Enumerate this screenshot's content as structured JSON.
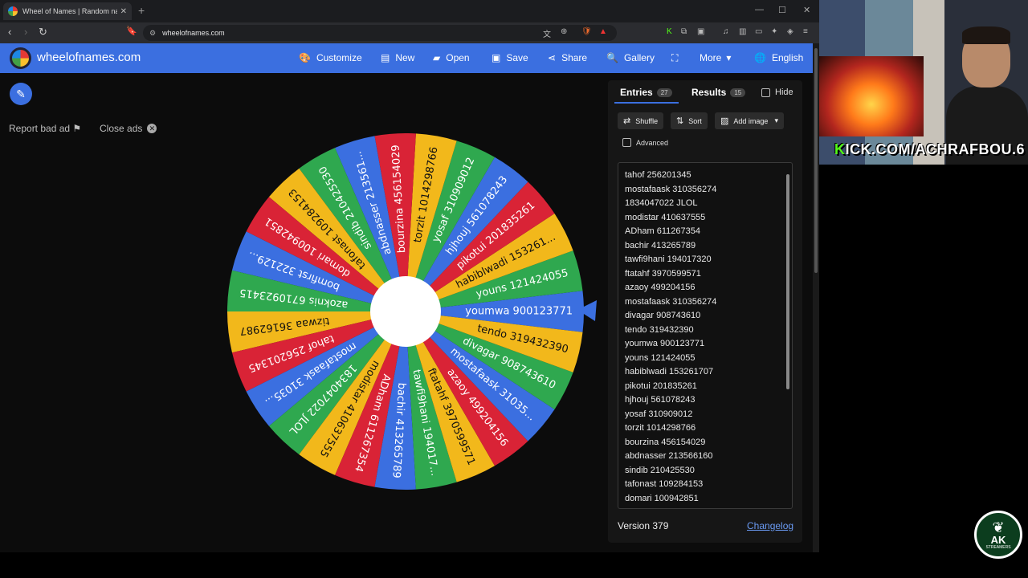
{
  "browser": {
    "tab_title": "Wheel of Names | Random name picker",
    "url": "wheelofnames.com"
  },
  "site": {
    "brand": "wheelofnames.com",
    "nav": [
      {
        "label": "Customize",
        "icon": "palette-icon"
      },
      {
        "label": "New",
        "icon": "file-icon"
      },
      {
        "label": "Open",
        "icon": "folder-open-icon"
      },
      {
        "label": "Save",
        "icon": "save-icon"
      },
      {
        "label": "Share",
        "icon": "share-icon"
      },
      {
        "label": "Gallery",
        "icon": "search-icon"
      },
      {
        "label": "",
        "icon": "fullscreen-icon"
      },
      {
        "label": "More",
        "icon": "chevron-down-icon"
      },
      {
        "label": "English",
        "icon": "globe-icon"
      }
    ],
    "report_bad_ad": "Report bad ad",
    "close_ads": "Close ads"
  },
  "wheel": {
    "colors": [
      "#3b6fe0",
      "#2fa84f",
      "#f2b81b",
      "#d92336"
    ],
    "segments": [
      "youmwa 900123771",
      "youns 121424055",
      "habiblwadi 153261...",
      "pikotui 201835261",
      "hjhouj 561078243",
      "yosaf 310909012",
      "torzit 1014298766",
      "bourzina 456154029",
      "abdnasser 213561...",
      "sindib 210425530",
      "tafonast 109284153",
      "domari 100942851",
      "bomfirst 322129...",
      "azoknis 6710923415",
      "tizwaa 36162987",
      "tahof 256201345",
      "mostafaask 31035...",
      "1834047022 JLOL",
      "modistar 410637555",
      "ADham 611267354",
      "bachir 413265789",
      "tawfi9hani 194017...",
      "ftatahf 3970599571",
      "azaoy 499204156",
      "mostafaask 31035...",
      "divagar 908743610",
      "tendo 319432390"
    ]
  },
  "panel": {
    "tabs": [
      {
        "label": "Entries",
        "count": "27"
      },
      {
        "label": "Results",
        "count": "15"
      }
    ],
    "hide_label": "Hide",
    "buttons": {
      "shuffle": "Shuffle",
      "sort": "Sort",
      "add_image": "Add image"
    },
    "advanced_label": "Advanced",
    "entries": [
      "tahof 256201345",
      "mostafaask 310356274",
      "1834047022 JLOL",
      "modistar 410637555",
      "ADham 611267354",
      "bachir 413265789",
      "tawfi9hani 194017320",
      "ftatahf 3970599571",
      "azaoy 499204156",
      "mostafaask 310356274",
      "divagar 908743610",
      "tendo 319432390",
      "youmwa 900123771",
      "youns 121424055",
      "habiblwadi 153261707",
      "pikotui 201835261",
      "hjhouj 561078243",
      "yosaf 310909012",
      "torzit 1014298766",
      "bourzina 456154029",
      "abdnasser 213566160",
      "sindib 210425530",
      "tafonast 109284153",
      "domari 100942851"
    ],
    "version": "Version 379",
    "changelog": "Changelog"
  },
  "stream": {
    "kick_url_k": "K",
    "kick_url_rest": "ICK.COM/ACHRAFBOU.6",
    "logo_text": "AK",
    "logo_sub": "STREAMERS"
  }
}
